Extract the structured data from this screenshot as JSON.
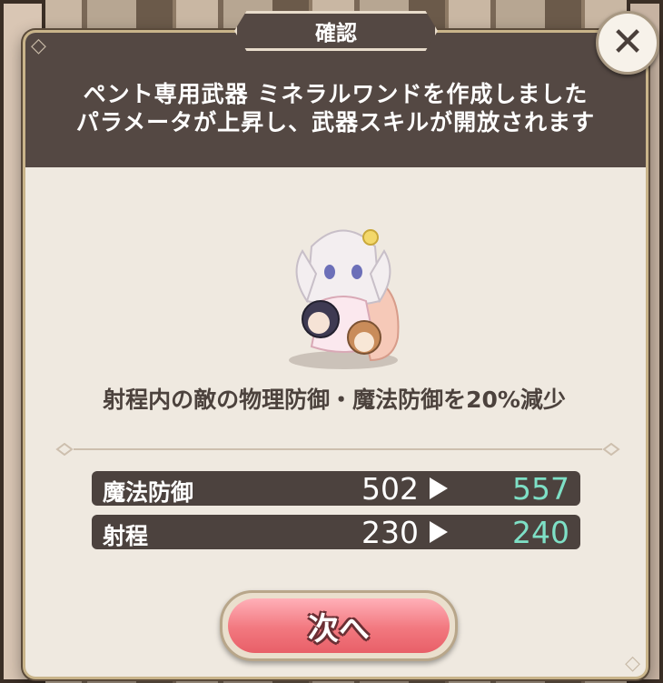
{
  "dialog": {
    "title": "確認",
    "message_line1": "ペント専用武器 ミネラルワンドを作成しました",
    "message_line2": "パラメータが上昇し、武器スキルが開放されます",
    "description": "射程内の敵の物理防御・魔法防御を20%減少"
  },
  "stats": [
    {
      "name": "魔法防御",
      "old": "502",
      "new": "557"
    },
    {
      "name": "射程",
      "old": "230",
      "new": "240"
    }
  ],
  "buttons": {
    "next_label": "次へ",
    "close_label": "✕"
  },
  "colors": {
    "header_bg": "#544843",
    "new_value": "#7ee0c6",
    "button_pink": "#f2787f"
  }
}
